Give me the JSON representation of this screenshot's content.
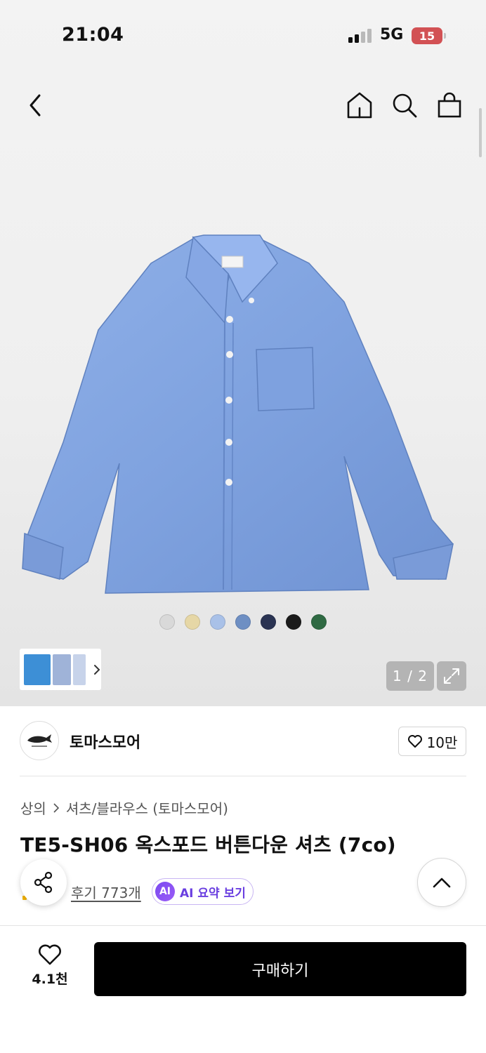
{
  "status_bar": {
    "time": "21:04",
    "network": "5G",
    "battery": "15"
  },
  "nav": {
    "back": "chevron-left",
    "home": "home-icon",
    "search": "search-icon",
    "cart": "bag-icon"
  },
  "gallery": {
    "color_swatches": [
      "#d9d9d9",
      "#e6d7a6",
      "#a9c1e8",
      "#6e8fc3",
      "#2a3352",
      "#1b1b1b",
      "#2f6a43"
    ],
    "thumb_colors": [
      "#3d8fd6",
      "#9fb3d8",
      "#c7d3ea"
    ],
    "counter": "1 / 2"
  },
  "brand": {
    "name": "토마스모어",
    "follow_count": "10만"
  },
  "breadcrumb": {
    "category": "상의",
    "subcategory": "셔츠/블라우스 (토마스모어)"
  },
  "product": {
    "title": "TE5-SH06 옥스포드 버튼다운 셔츠 (7co)"
  },
  "reviews": {
    "label": "후기 773개"
  },
  "ai_summary": {
    "badge": "AI",
    "label": "AI 요약 보기"
  },
  "bottom": {
    "like_count": "4.1천",
    "buy_label": "구매하기"
  },
  "colors": {
    "accent_purple": "#6a3fe0",
    "buy_button": "#000000",
    "battery": "#d25154"
  }
}
